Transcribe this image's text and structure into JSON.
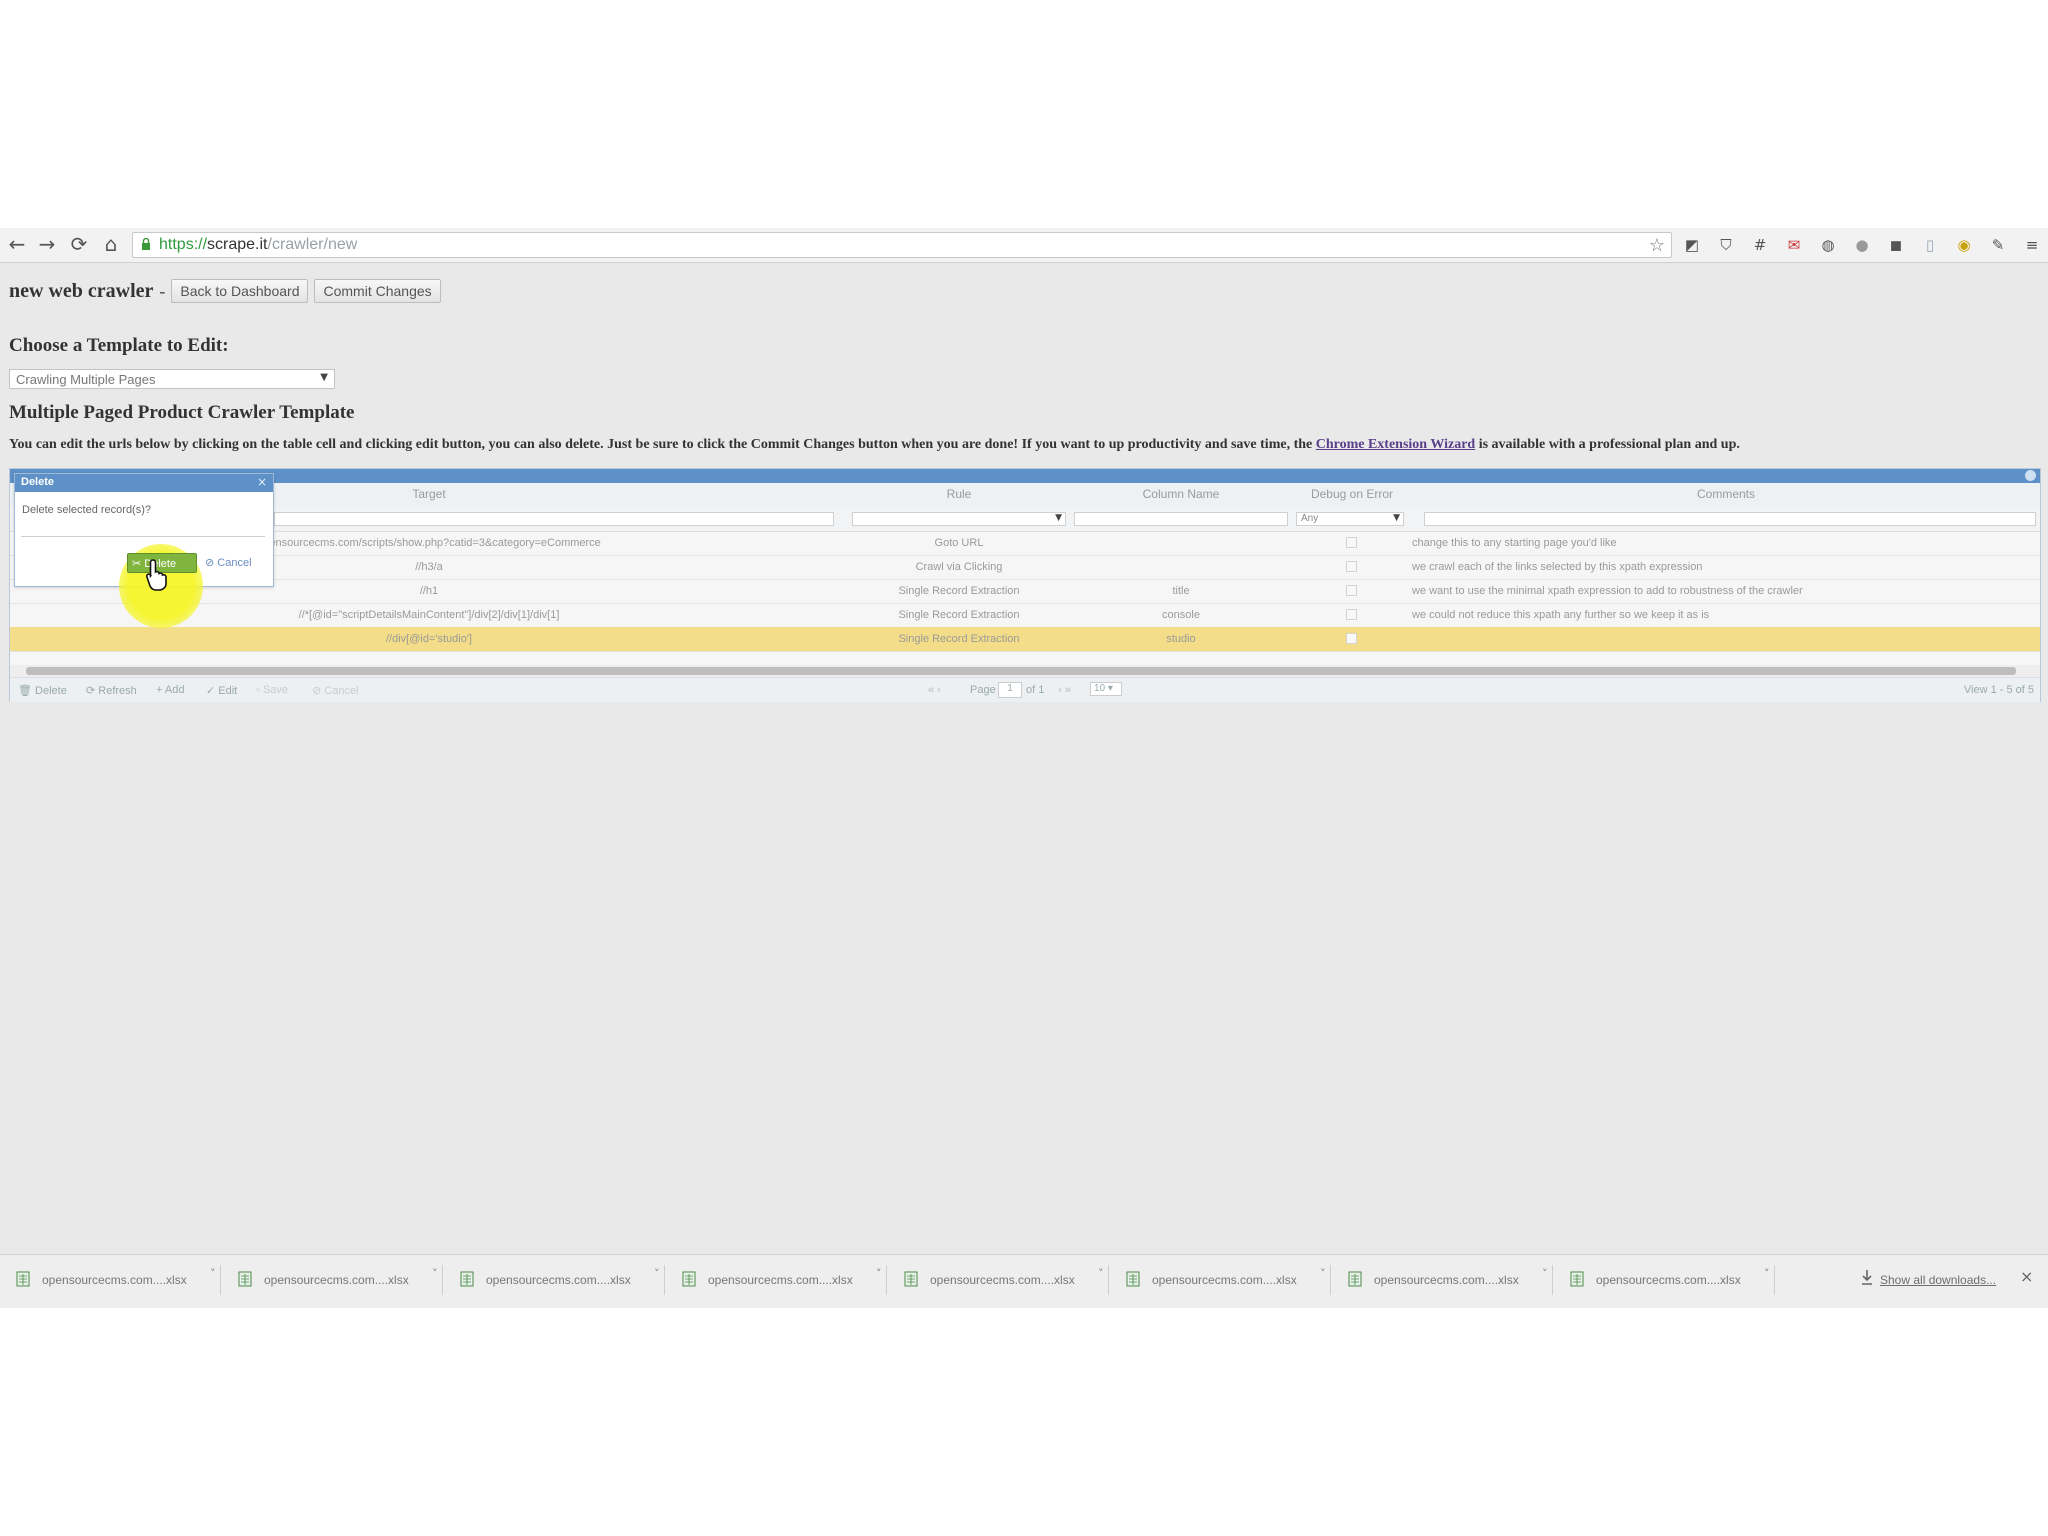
{
  "browser": {
    "url_scheme": "https://",
    "url_host": "scrape.it",
    "url_path": "/crawler/new",
    "extension_icons": [
      "bookmark-icon",
      "shield-icon",
      "grid-icon",
      "mail-icon",
      "globe-icon",
      "dot-icon",
      "puzzle-icon",
      "doc-icon",
      "chrome-icon",
      "wrench-icon",
      "menu-icon"
    ]
  },
  "header": {
    "title": "new web crawler",
    "separator": "-",
    "back_label": "Back to Dashboard",
    "commit_label": "Commit Changes"
  },
  "template": {
    "choose_label": "Choose a Template to Edit:",
    "selected": "Crawling Multiple Pages",
    "heading": "Multiple Paged Product Crawler Template",
    "instructions_before": "You can edit the urls below by clicking on the table cell and clicking edit button, you can also delete. Just be sure to click the Commit Changes button when you are done! If you want to up productivity and save time, the ",
    "instructions_link": "Chrome Extension Wizard",
    "instructions_after": " is available with a professional plan and up."
  },
  "grid": {
    "columns": [
      "Target",
      "Rule",
      "Column Name",
      "Debug on Error",
      "Comments"
    ],
    "filter_debug_value": "Any",
    "rows": [
      {
        "target": "opensourcecms.com/scripts/show.php?catid=3&category=eCommerce",
        "rule": "Goto URL",
        "column": "",
        "comment": "change this to any starting page you'd like"
      },
      {
        "target": "//h3/a",
        "rule": "Crawl via Clicking",
        "column": "",
        "comment": "we crawl each of the links selected by this xpath expression"
      },
      {
        "target": "//h1",
        "rule": "Single Record Extraction",
        "column": "title",
        "comment": "we want to use the minimal xpath expression to add to robustness of the crawler"
      },
      {
        "target": "//*[@id=\"scriptDetailsMainContent\"]/div[2]/div[1]/div[1]",
        "rule": "Single Record Extraction",
        "column": "console",
        "comment": "we could not reduce this xpath any further so we keep it as is"
      },
      {
        "target": "//div[@id='studio']",
        "rule": "Single Record Extraction",
        "column": "studio",
        "comment": ""
      }
    ],
    "pager": {
      "delete": "Delete",
      "refresh": "Refresh",
      "add": "Add",
      "edit": "Edit",
      "save": "Save",
      "cancel": "Cancel",
      "page_label": "Page",
      "page_value": "1",
      "of_label": "of 1",
      "page_size": "10",
      "view_info": "View 1 - 5 of 5"
    }
  },
  "dialog": {
    "title": "Delete",
    "message": "Delete selected record(s)?",
    "delete_label": "Delete",
    "cancel_label": "Cancel"
  },
  "downloads": {
    "items": [
      "opensourcecms.com....xlsx",
      "opensourcecms.com....xlsx",
      "opensourcecms.com....xlsx",
      "opensourcecms.com....xlsx",
      "opensourcecms.com....xlsx",
      "opensourcecms.com....xlsx",
      "opensourcecms.com....xlsx",
      "opensourcecms.com....xlsx"
    ],
    "show_all": "Show all downloads..."
  },
  "colors": {
    "grid_caption": "#5d91c8",
    "selected_row": "#f3dd88",
    "dialog_delete": "#7fb43f",
    "highlight": "#f5f528"
  }
}
